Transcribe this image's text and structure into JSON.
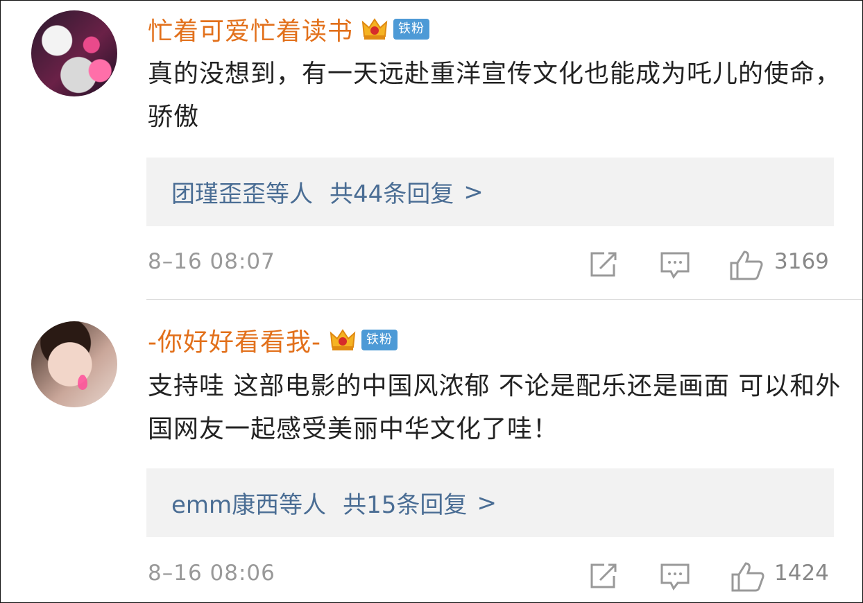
{
  "comments": [
    {
      "username": "忙着可爱忙着读书",
      "badge": "铁粉",
      "text": "真的没想到，有一天远赴重洋宣传文化也能成为吒儿的使命，骄傲",
      "replies": {
        "who": "团瑾歪歪等人",
        "count": "共44条回复",
        "arrow": ">"
      },
      "time": "8–16 08:07",
      "likes": "3169"
    },
    {
      "username": "-你好好看看我-",
      "badge": "铁粉",
      "text": "支持哇 这部电影的中国风浓郁 不论是配乐还是画面 可以和外国网友一起感受美丽中华文化了哇！",
      "replies": {
        "who": "emm康西等人",
        "count": "共15条回复",
        "arrow": ">"
      },
      "time": "8–16 08:06",
      "likes": "1424"
    }
  ],
  "icons": {
    "crown": "crown-icon",
    "share": "share-icon",
    "comment": "comment-icon",
    "like": "thumbs-up-icon"
  },
  "colors": {
    "username": "#e2701b",
    "badge": "#4d9ad6",
    "reply_link": "#4a6d94",
    "meta": "#999999"
  }
}
